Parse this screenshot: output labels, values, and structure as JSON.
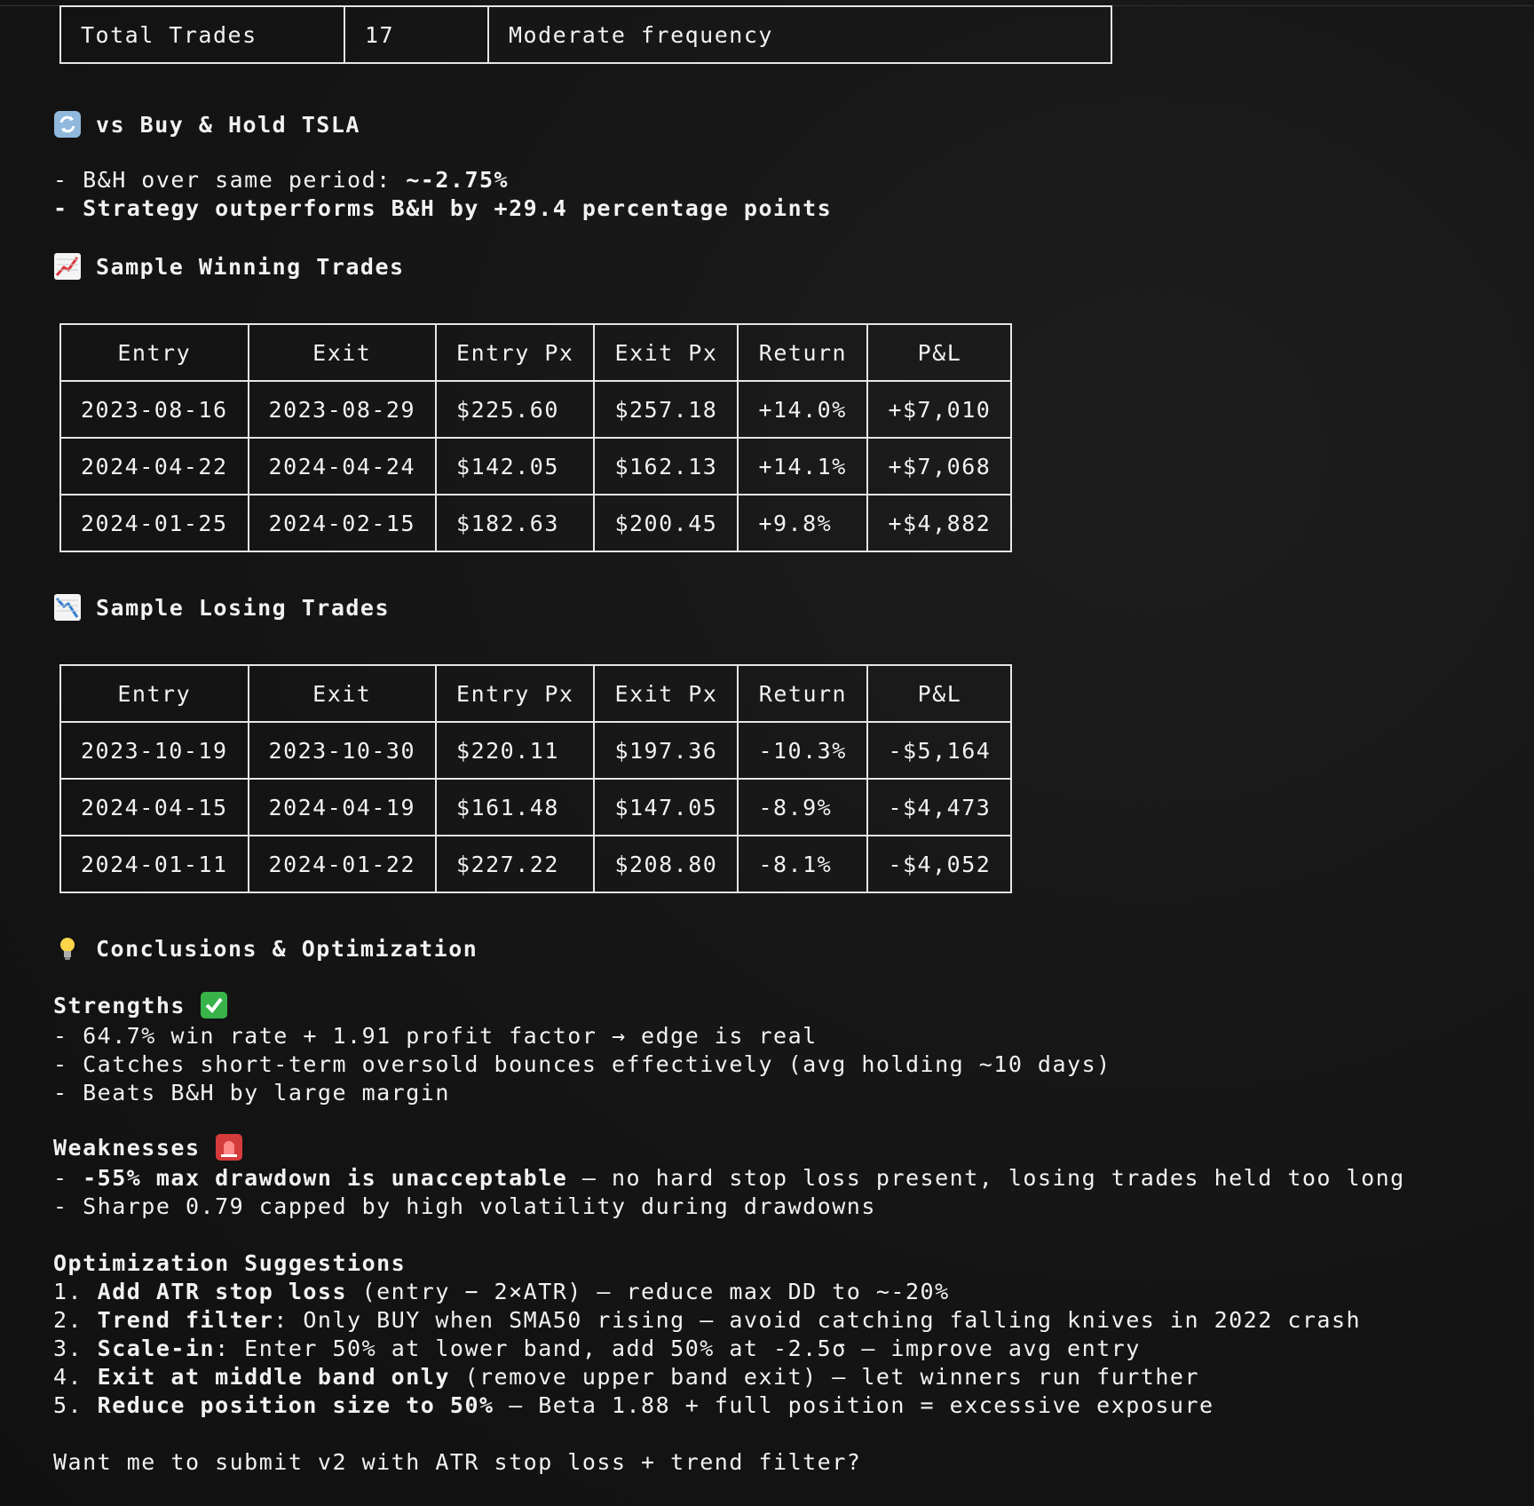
{
  "summary_table": {
    "rows": [
      {
        "metric": "Total Trades",
        "value": "17",
        "note": "Moderate frequency"
      }
    ]
  },
  "vs_bh": {
    "title": "vs Buy & Hold TSLA",
    "icon": "refresh-icon",
    "line1_prefix": "- B&H over same period: ",
    "line1_value": "~-2.75%",
    "line2": "- Strategy outperforms B&H by +29.4 percentage points"
  },
  "winning": {
    "title": "Sample Winning Trades",
    "icon": "chart-up-icon",
    "headers": [
      "Entry",
      "Exit",
      "Entry Px",
      "Exit Px",
      "Return",
      "P&L"
    ],
    "rows": [
      [
        "2023-08-16",
        "2023-08-29",
        "$225.60",
        "$257.18",
        "+14.0%",
        "+$7,010"
      ],
      [
        "2024-04-22",
        "2024-04-24",
        "$142.05",
        "$162.13",
        "+14.1%",
        "+$7,068"
      ],
      [
        "2024-01-25",
        "2024-02-15",
        "$182.63",
        "$200.45",
        "+9.8%",
        "+$4,882"
      ]
    ]
  },
  "losing": {
    "title": "Sample Losing Trades",
    "icon": "chart-down-icon",
    "headers": [
      "Entry",
      "Exit",
      "Entry Px",
      "Exit Px",
      "Return",
      "P&L"
    ],
    "rows": [
      [
        "2023-10-19",
        "2023-10-30",
        "$220.11",
        "$197.36",
        "-10.3%",
        "-$5,164"
      ],
      [
        "2024-04-15",
        "2024-04-19",
        "$161.48",
        "$147.05",
        "-8.9%",
        "-$4,473"
      ],
      [
        "2024-01-11",
        "2024-01-22",
        "$227.22",
        "$208.80",
        "-8.1%",
        "-$4,052"
      ]
    ]
  },
  "conclusions": {
    "title": "Conclusions & Optimization",
    "icon": "lightbulb-icon",
    "strengths_title": "Strengths",
    "strengths_icon": "check-mark-icon",
    "strengths": [
      "- 64.7% win rate + 1.91 profit factor → edge is real",
      "- Catches short-term oversold bounces effectively (avg holding ~10 days)",
      "- Beats B&H by large margin"
    ],
    "weaknesses_title": "Weaknesses",
    "weaknesses_icon": "siren-icon",
    "weakness1_bold": "-55% max drawdown is unacceptable",
    "weakness1_rest": " — no hard stop loss present, losing trades held too long",
    "weakness2": "- Sharpe 0.79 capped by high volatility during drawdowns",
    "opt_title": "Optimization Suggestions",
    "suggestions": [
      {
        "num": "1. ",
        "bold": "Add ATR stop loss",
        "rest": " (entry − 2×ATR) — reduce max DD to ~-20%"
      },
      {
        "num": "2. ",
        "bold": "Trend filter",
        "rest": ": Only BUY when SMA50 rising — avoid catching falling knives in 2022 crash"
      },
      {
        "num": "3. ",
        "bold": "Scale-in",
        "rest": ": Enter 50% at lower band, add 50% at -2.5σ — improve avg entry"
      },
      {
        "num": "4. ",
        "bold": "Exit at middle band only",
        "rest": " (remove upper band exit) — let winners run further"
      },
      {
        "num": "5. ",
        "bold": "Reduce position size to 50%",
        "rest": " — Beta 1.88 + full position = excessive exposure"
      }
    ],
    "question": "Want me to submit v2 with ATR stop loss + trend filter?"
  }
}
